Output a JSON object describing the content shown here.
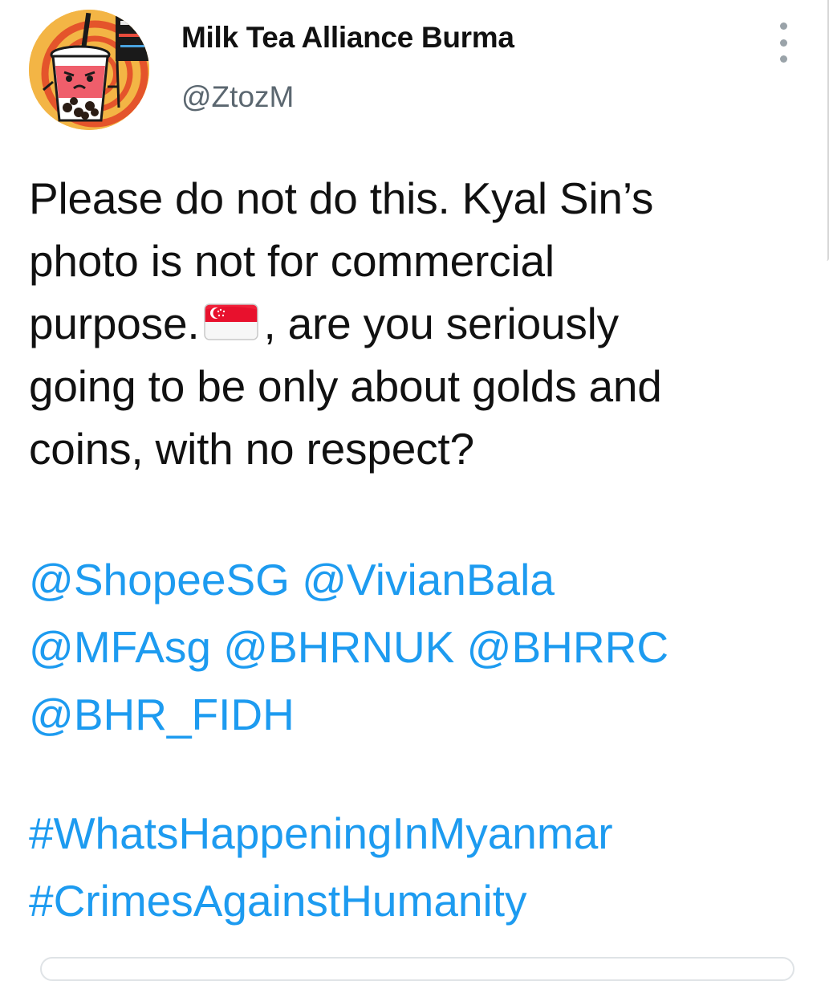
{
  "tweet": {
    "author": {
      "display_name": "Milk Tea Alliance Burma",
      "handle": "@ZtozM",
      "avatar_icon": "bubble-tea-mascot-avatar"
    },
    "more_icon": "more-vertical-icon",
    "body": {
      "line1": "Please do not do this. Kyal Sin’s",
      "line2": "photo is not for commercial",
      "line3_before_flag": "purpose.",
      "flag_emoji": "singapore-flag",
      "line3_after_flag": ", are you seriously",
      "line4": "going to be only about golds and",
      "line5": "coins, with no respect?"
    },
    "mentions": [
      "@ShopeeSG",
      "@VivianBala",
      "@MFAsg",
      "@BHRNUK",
      "@BHRRC",
      "@BHR_FIDH"
    ],
    "hashtags": [
      "#WhatsHappeningInMyanmar",
      "#CrimesAgainstHumanity"
    ]
  },
  "colors": {
    "link": "#1d9bf0",
    "text": "#111111",
    "secondary_text": "#5b6770",
    "avatar_bg": "#f3b545"
  }
}
